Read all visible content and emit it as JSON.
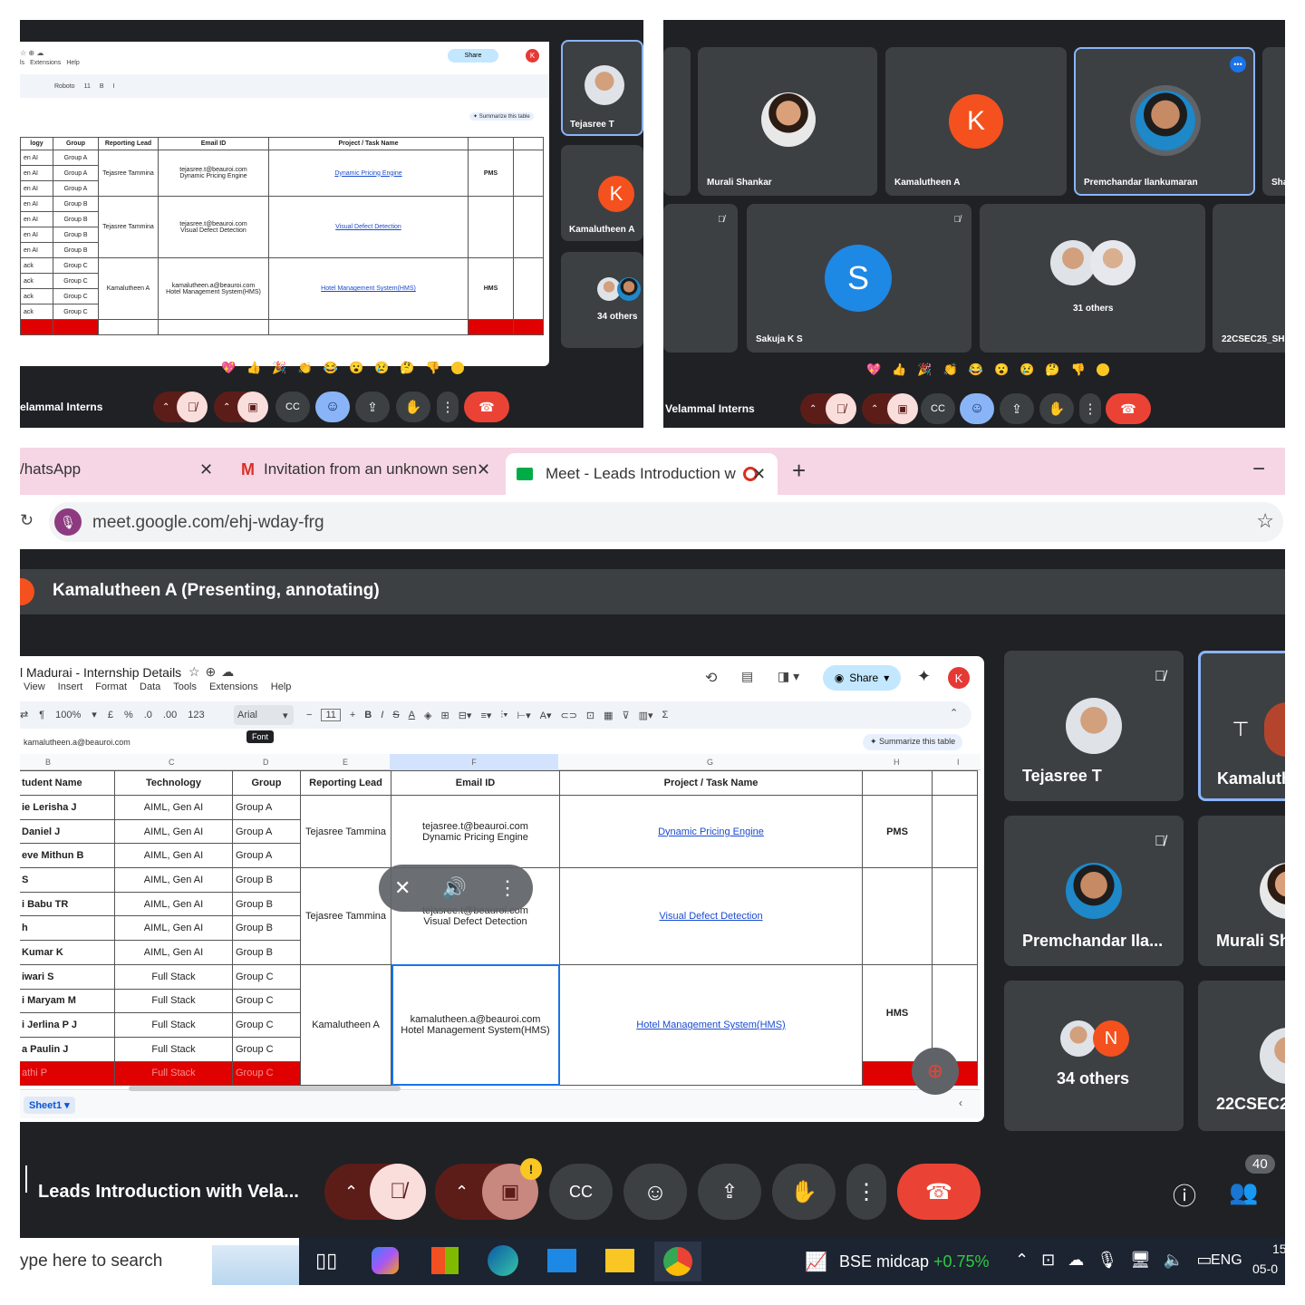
{
  "meet": {
    "call_name_short": "elammal Interns",
    "call_name_short2": "Velammal Interns",
    "reactions": [
      "💖",
      "👍",
      "🎉",
      "👏",
      "😂",
      "😮",
      "😢",
      "🤔",
      "👎"
    ],
    "tiles_tl": {
      "p1": "Tejasree T",
      "p2": "Kamalutheen A",
      "p3": "34 others",
      "avatar_letter": "K"
    },
    "tiles_tr": {
      "r1": [
        "Murali Shankar",
        "Kamalutheen A",
        "Premchandar Ilankumaran",
        "Sha"
      ],
      "r2": [
        "Sakuja K S",
        "31 others",
        "22CSEC25_SHE"
      ],
      "letter_k": "K",
      "letter_s": "S"
    }
  },
  "browser": {
    "tabs": [
      {
        "label": "/hatsApp"
      },
      {
        "label": "Invitation from an unknown sen"
      },
      {
        "label": "Meet - Leads Introduction w"
      }
    ],
    "new_tab": "+",
    "minimize": "−",
    "url": "meet.google.com/ehj-wday-frg"
  },
  "presenter_banner": "Kamalutheen A (Presenting, annotating)",
  "sheet": {
    "title": "l Madurai - Internship Details",
    "menus": [
      "View",
      "Insert",
      "Format",
      "Data",
      "Tools",
      "Extensions",
      "Help"
    ],
    "menus_small": [
      "ls",
      "Extensions",
      "Help"
    ],
    "zoom": "100%",
    "currency": "£",
    "percent": "%",
    "dec0": ".0",
    "dec00": ".00",
    "num": "123",
    "font": "Arial",
    "font_small": "Roboto",
    "font_size": "11",
    "font_tooltip": "Font",
    "share": "Share",
    "avatar": "K",
    "cell_ref": "kamalutheen.a@beauroi.com",
    "summarize": "Summarize this table",
    "col_letters": [
      "B",
      "C",
      "D",
      "E",
      "F",
      "G",
      "H",
      "I"
    ],
    "headers": [
      "tudent Name",
      "Technology",
      "Group",
      "Reporting Lead",
      "Email ID",
      "Project / Task Name"
    ],
    "headers_small": [
      "logy",
      "Group",
      "Reporting Lead",
      "Email ID",
      "Project / Task Name"
    ],
    "students": [
      "ie Lerisha J",
      "Daniel J",
      "eve Mithun B",
      "S",
      "i Babu TR",
      "h",
      "Kumar K",
      "iwari S",
      "i Maryam M",
      "i Jerlina P J",
      "a Paulin J",
      "athi P"
    ],
    "tech": [
      "AIML, Gen AI",
      "AIML, Gen AI",
      "AIML, Gen AI",
      "AIML, Gen AI",
      "AIML, Gen AI",
      "AIML, Gen AI",
      "AIML, Gen AI",
      "Full Stack",
      "Full Stack",
      "Full Stack",
      "Full Stack",
      "Full Stack"
    ],
    "tech_small": [
      "en AI",
      "en AI",
      "en AI",
      "en AI",
      "en AI",
      "en AI",
      "en AI",
      "ack",
      "ack",
      "ack",
      "ack",
      "ack"
    ],
    "groups": [
      "Group A",
      "Group A",
      "Group A",
      "Group B",
      "Group B",
      "Group B",
      "Group B",
      "Group C",
      "Group C",
      "Group C",
      "Group C",
      "Group C"
    ],
    "leads": [
      "Tejasree Tammina",
      "Tejasree Tammina",
      "Kamalutheen A"
    ],
    "emails": [
      {
        "email": "tejasree.t@beauroi.com",
        "task": "Dynamic Pricing Engine"
      },
      {
        "email": "tejasree.t@beauroi.com",
        "task": "Visual Defect Detection"
      },
      {
        "email": "kamalutheen.a@beauroi.com",
        "task": "Hotel Management System(HMS)"
      }
    ],
    "projects": [
      "Dynamic Pricing Engine",
      "Visual Defect Detection",
      "Hotel Management System(HMS)"
    ],
    "codes": [
      "PMS",
      "HMS"
    ],
    "sheet_tab": "Sheet1"
  },
  "side_tiles": [
    "Tejasree T",
    "Kamaluth",
    "Premchandar Ila...",
    "Murali Sh",
    "34 others",
    "22CSEC2"
  ],
  "side_letter": "N",
  "bottom": {
    "meeting_name": "Leads Introduction with Vela...",
    "participants": "40"
  },
  "taskbar": {
    "search": "ype here to search",
    "stock_name": "BSE midcap",
    "stock_change": "+0.75%",
    "lang": "ENG",
    "time": "15",
    "date": "05-0"
  },
  "colors": {
    "accent": "#8ab4f8",
    "end_call": "#ea4335",
    "muted": "#f9dedc",
    "orange": "#f4511e",
    "blue": "#1a73e8"
  }
}
